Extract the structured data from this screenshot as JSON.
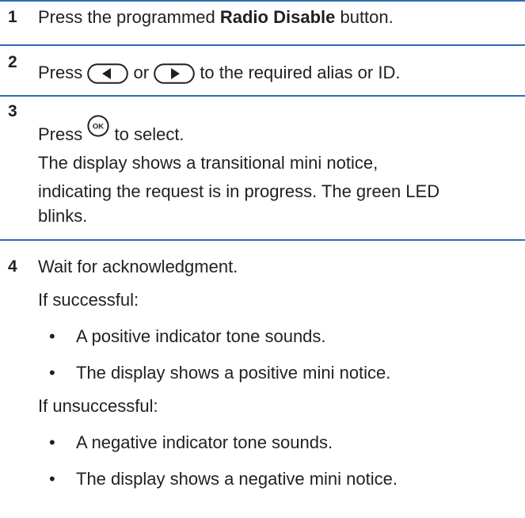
{
  "steps": [
    {
      "number": "1",
      "pre": "Press the programmed ",
      "strong": "Radio Disable",
      "post": " button."
    },
    {
      "number": "2",
      "w1": "Press",
      "w2": "or",
      "w3": "to the required alias or ID.",
      "icons": [
        "left-arrow-key-icon",
        "right-arrow-key-icon"
      ]
    },
    {
      "number": "3",
      "w1": "Press",
      "w2": "to select.",
      "icon": "ok-key-icon",
      "icon_text": "OK",
      "note_line1": "The display shows a transitional mini notice,",
      "note_line2": "indicating the request is in progress. The green LED",
      "note_line3": "blinks."
    },
    {
      "number": "4",
      "text": "Wait for acknowledgment.",
      "success_label": "If successful:",
      "success_items": [
        "A positive indicator tone sounds.",
        "The display shows a positive mini notice."
      ],
      "fail_label": "If unsuccessful:",
      "fail_items": [
        "A negative indicator tone sounds.",
        "The display shows a negative mini notice."
      ]
    }
  ],
  "bullet_char": "•",
  "rule_color": "#2e6db3"
}
